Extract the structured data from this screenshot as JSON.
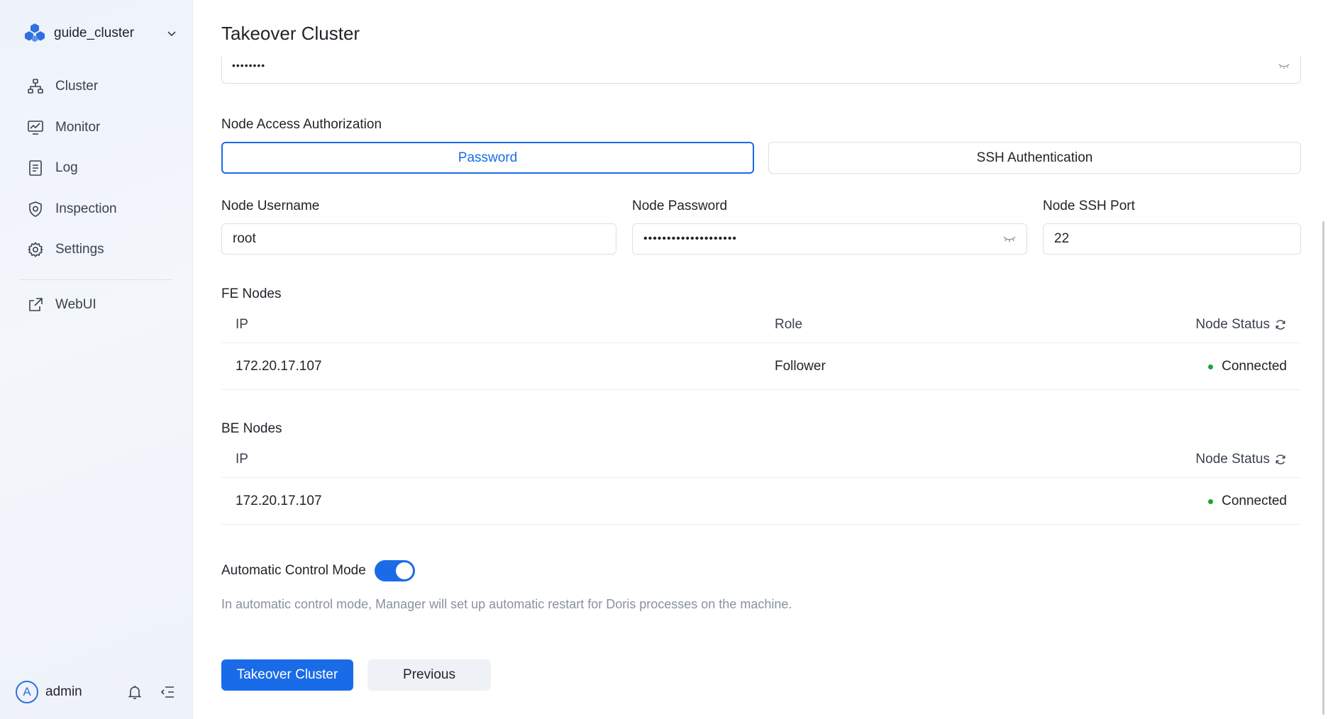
{
  "sidebar": {
    "cluster_name": "guide_cluster",
    "nav_items": [
      {
        "label": "Cluster",
        "icon": "cluster-icon"
      },
      {
        "label": "Monitor",
        "icon": "monitor-icon"
      },
      {
        "label": "Log",
        "icon": "log-icon"
      },
      {
        "label": "Inspection",
        "icon": "inspection-icon"
      },
      {
        "label": "Settings",
        "icon": "settings-icon"
      }
    ],
    "webui_label": "WebUI",
    "user": {
      "initial": "A",
      "name": "admin"
    }
  },
  "page": {
    "title": "Takeover Cluster",
    "previous_password_mask": "••••••••"
  },
  "auth": {
    "label": "Node Access Authorization",
    "tabs": [
      "Password",
      "SSH Authentication"
    ],
    "active_tab": "Password"
  },
  "fields": {
    "username_label": "Node Username",
    "username_value": "root",
    "password_label": "Node Password",
    "password_mask": "••••••••••••••••••••",
    "port_label": "Node SSH Port",
    "port_value": "22"
  },
  "fe_nodes": {
    "title": "FE Nodes",
    "columns": {
      "ip": "IP",
      "role": "Role",
      "status": "Node Status"
    },
    "rows": [
      {
        "ip": "172.20.17.107",
        "role": "Follower",
        "status": "Connected"
      }
    ]
  },
  "be_nodes": {
    "title": "BE Nodes",
    "columns": {
      "ip": "IP",
      "status": "Node Status"
    },
    "rows": [
      {
        "ip": "172.20.17.107",
        "status": "Connected"
      }
    ]
  },
  "auto_control": {
    "label": "Automatic Control Mode",
    "enabled": true,
    "hint": "In automatic control mode, Manager will set up automatic restart for Doris processes on the machine."
  },
  "buttons": {
    "takeover": "Takeover Cluster",
    "previous": "Previous"
  },
  "colors": {
    "accent": "#1a6be8",
    "status_connected": "#1fa33a",
    "sidebar_bg": "#eef3fb"
  }
}
